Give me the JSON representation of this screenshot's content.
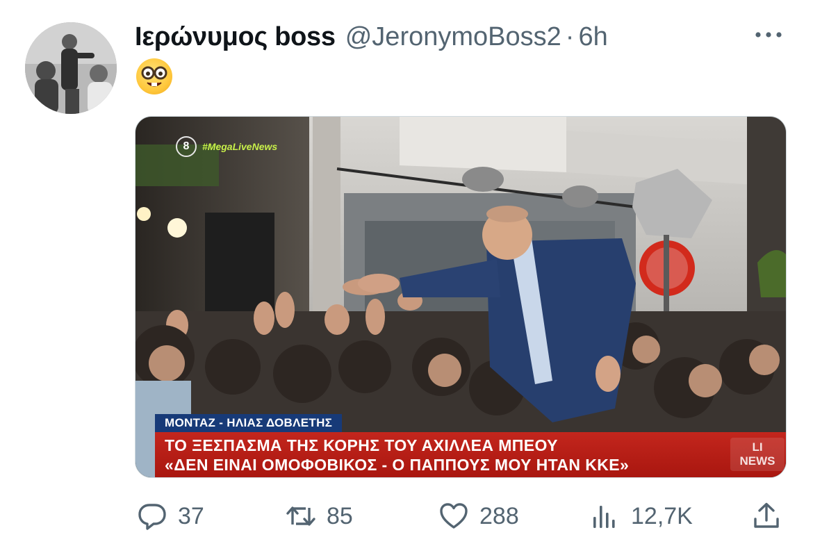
{
  "tweet": {
    "display_name": "Ιερώνυμος boss",
    "handle": "@JeronymoBoss2",
    "separator": "·",
    "time": "6h",
    "emoji_name": "nerd-face-emoji",
    "more_icon": "more-dots-icon"
  },
  "media": {
    "channel_number": "8",
    "hashtag": "#MegaLiveNews",
    "credit": "ΜΟΝΤΑΖ - ΗΛΙΑΣ ΔΟΒΛΕΤΗΣ",
    "headline_line1": "ΤΟ ΞΕΣΠΑΣΜΑ ΤΗΣ ΚΟΡΗΣ ΤΟΥ ΑΧΙΛΛΕΑ ΜΠΕΟΥ",
    "headline_line2": "«ΔΕΝ ΕΙΝΑΙ ΟΜΟΦΟΒΙΚΟΣ - Ο ΠΑΠΠΟΥΣ ΜΟΥ ΗΤΑΝ ΚΚΕ»",
    "live_top": "LI",
    "live_bottom": "NEWS"
  },
  "actions": {
    "reply_count": "37",
    "retweet_count": "85",
    "like_count": "288",
    "views_count": "12,7K"
  },
  "colors": {
    "text_primary": "#0f1419",
    "text_secondary": "#536471",
    "headline_red": "#b81d15",
    "credit_blue": "#173a78"
  }
}
